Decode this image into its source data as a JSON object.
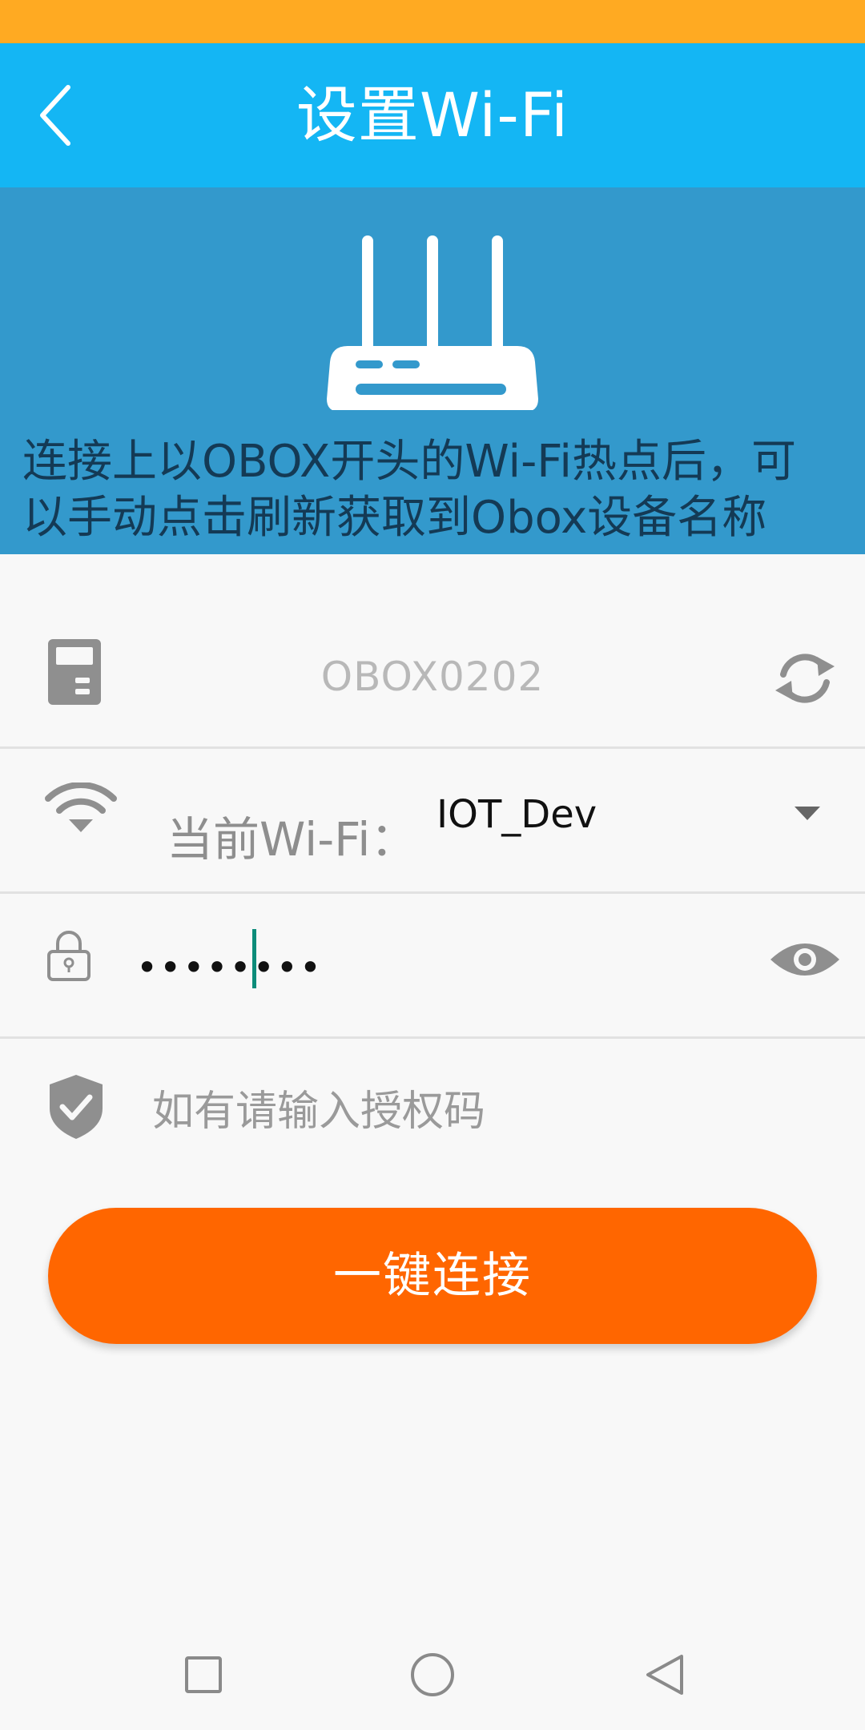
{
  "status_bar": {
    "color": "#ffaa22"
  },
  "app_bar": {
    "title": "设置Wi-Fi",
    "back_icon": "chevron-left-icon",
    "color": "#14b6f4"
  },
  "banner": {
    "icon": "router-icon",
    "lines": [
      "连接上以OBOX开头的Wi-Fi热点后，可",
      "以手动点击刷新获取到Obox设备名称"
    ],
    "color": "#3399cc"
  },
  "device": {
    "icon": "device-icon",
    "name": "OBOX0202",
    "refresh_icon": "refresh-icon"
  },
  "wifi": {
    "icon": "wifi-icon",
    "label": "当前Wi-Fi：",
    "selected": "IOT_Dev",
    "dropdown_icon": "caret-down-icon"
  },
  "password": {
    "icon": "lock-icon",
    "value": "••••••••",
    "visibility_icon": "eye-icon"
  },
  "auth_code": {
    "icon": "shield-check-icon",
    "placeholder": "如有请输入授权码"
  },
  "connect_button": {
    "label": "一键连接",
    "color": "#ff6600"
  },
  "nav_bar": {
    "items": [
      "square-icon",
      "circle-icon",
      "triangle-back-icon"
    ]
  }
}
